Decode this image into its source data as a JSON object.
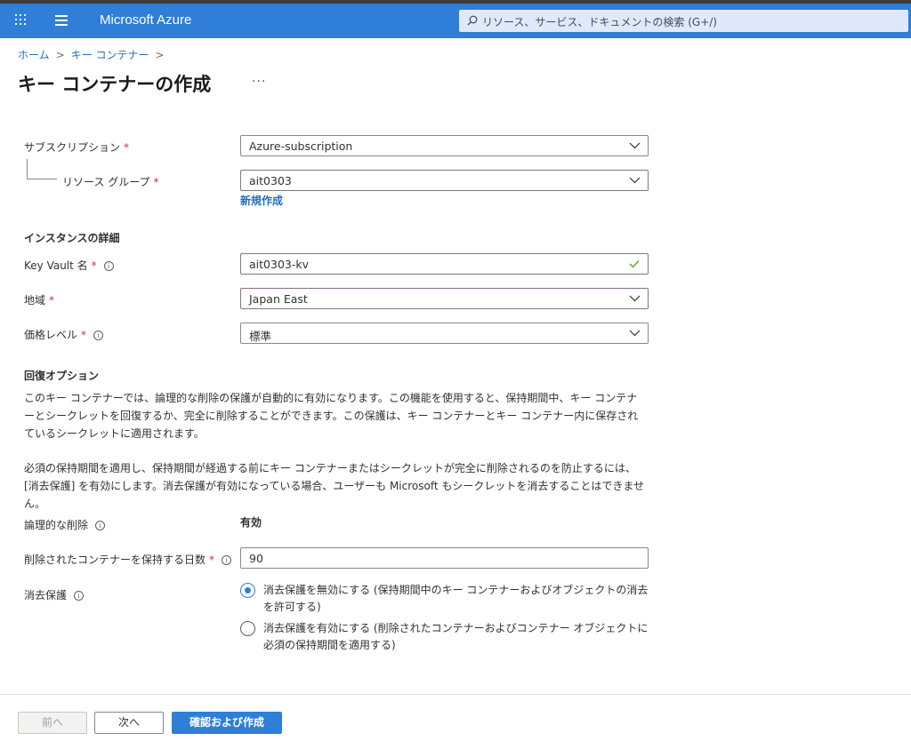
{
  "header": {
    "brand": "Microsoft Azure",
    "search_placeholder": "リソース、サービス、ドキュメントの検索 (G+/)",
    "accent_color": "#2f7fd8"
  },
  "breadcrumb": {
    "home": "ホーム",
    "key_vault": "キー コンテナー",
    "separator": ">"
  },
  "page": {
    "title": "キー コンテナーの作成",
    "more": "···"
  },
  "form": {
    "subscription": {
      "label": "サブスクリプション",
      "value": "Azure-subscription"
    },
    "resource_group": {
      "label": "リソース グループ",
      "value": "ait0303",
      "new_link": "新規作成"
    },
    "instance_section": "インスタンスの詳細",
    "key_vault_name": {
      "label": "Key Vault 名",
      "value": "ait0303-kv"
    },
    "region": {
      "label": "地域",
      "value": "Japan East"
    },
    "pricing_tier": {
      "label": "価格レベル",
      "value": "標準"
    },
    "required_mark": "*",
    "info_glyph": "i"
  },
  "recovery": {
    "heading": "回復オプション",
    "paragraph1": "このキー コンテナーでは、論理的な削除の保護が自動的に有効になります。この機能を使用すると、保持期間中、キー コンテナーとシークレットを回復するか、完全に削除することができます。この保護は、キー コンテナーとキー コンテナー内に保存されているシークレットに適用されます。",
    "paragraph2": "必須の保持期間を適用し、保持期間が経過する前にキー コンテナーまたはシークレットが完全に削除されるのを防止するには、[消去保護] を有効にします。消去保護が有効になっている場合、ユーザーも Microsoft もシークレットを消去することはできません。",
    "soft_delete": {
      "label": "論理的な削除",
      "value": "有効"
    },
    "retention_days": {
      "label": "削除されたコンテナーを保持する日数",
      "value": "90"
    },
    "purge_protection": {
      "label": "消去保護",
      "options": [
        {
          "label": "消去保護を無効にする (保持期間中のキー コンテナーおよびオブジェクトの消去を許可する)",
          "selected": true
        },
        {
          "label": "消去保護を有効にする (削除されたコンテナーおよびコンテナー オブジェクトに必須の保持期間を適用する)",
          "selected": false
        }
      ]
    }
  },
  "footer": {
    "prev": "前へ",
    "next": "次へ",
    "create": "確認および作成"
  }
}
